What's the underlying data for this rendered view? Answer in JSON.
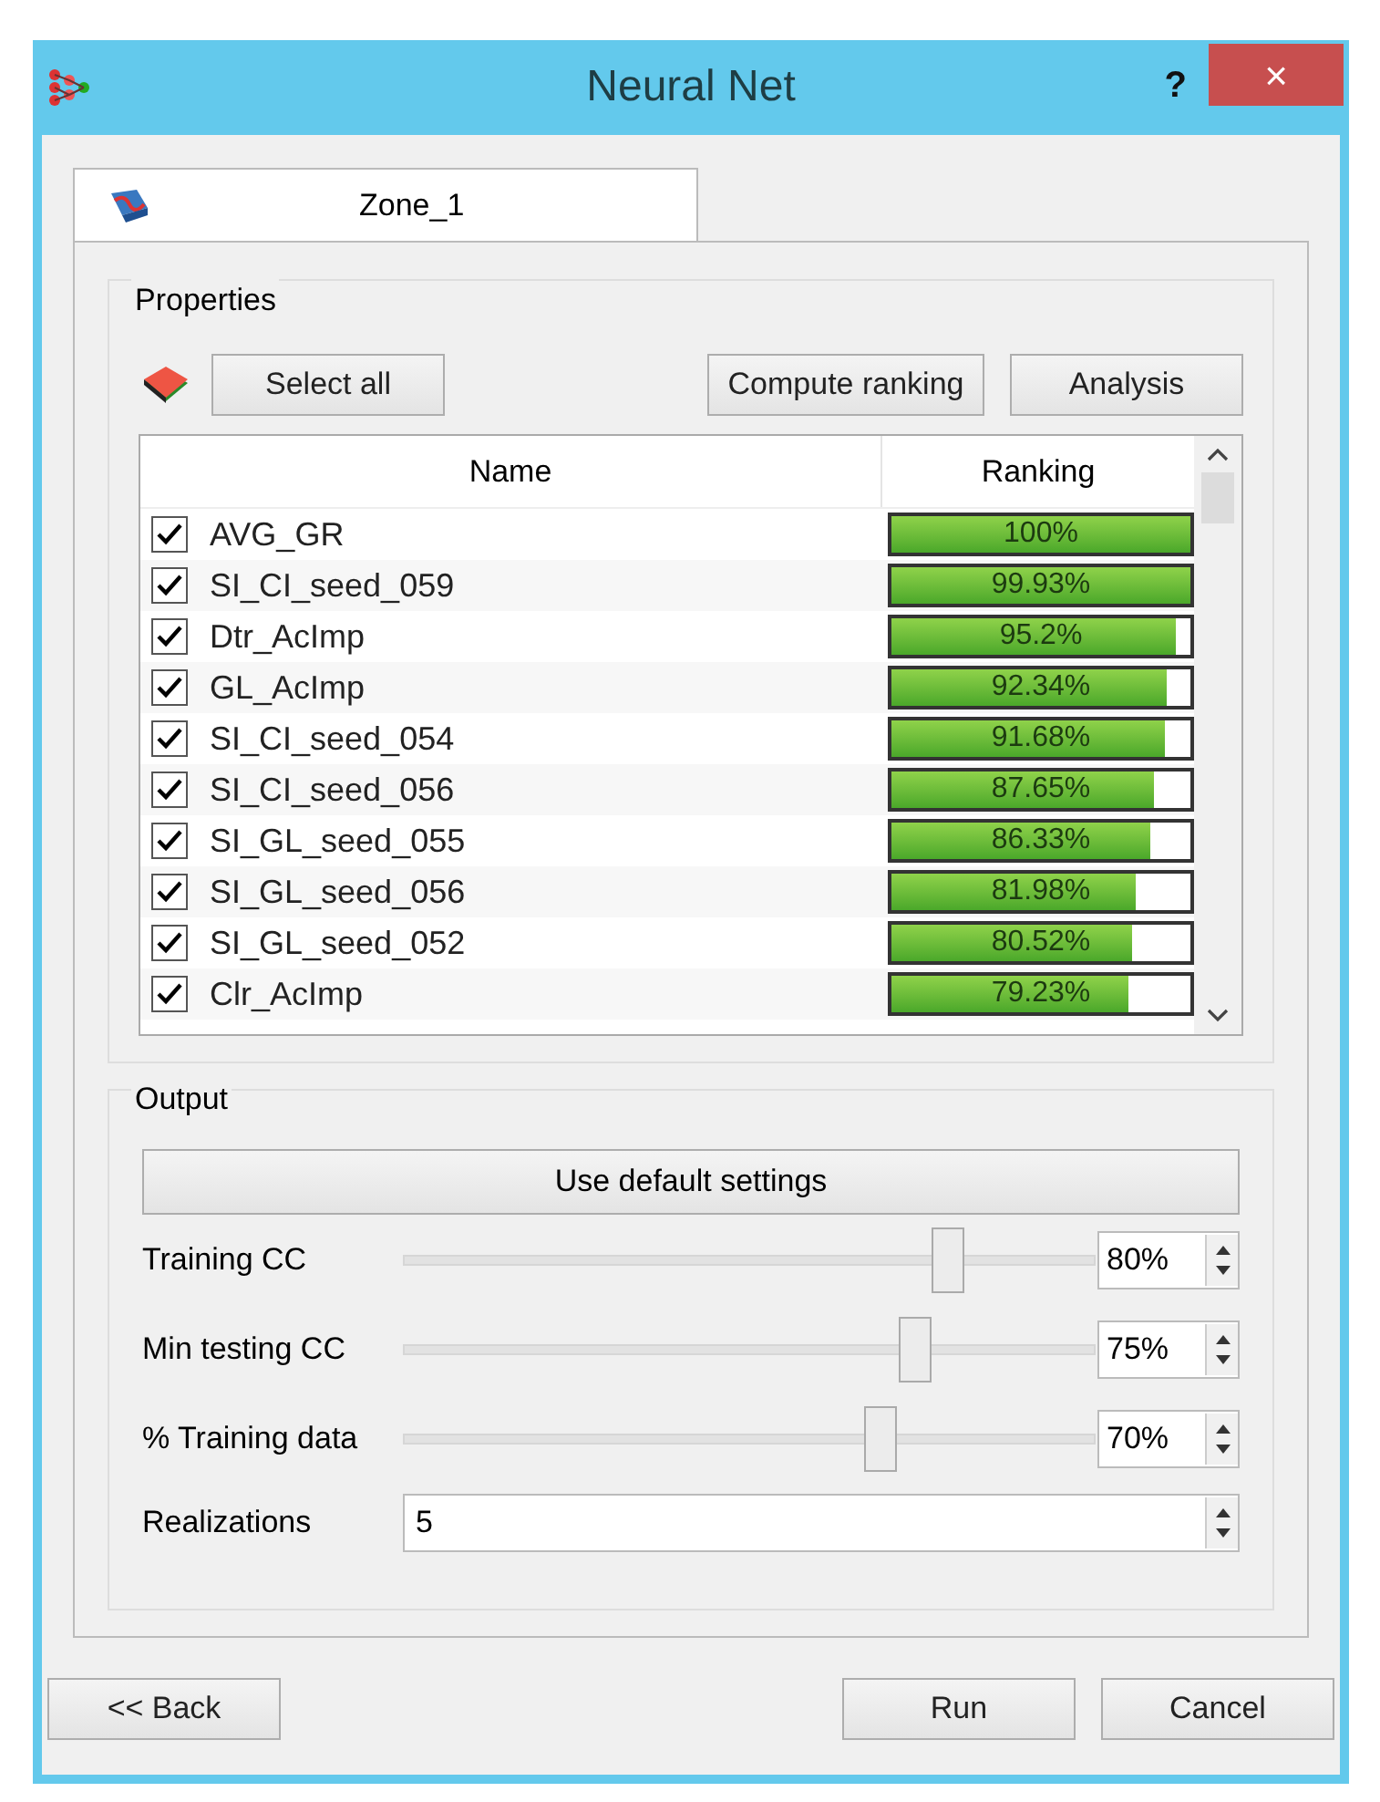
{
  "window": {
    "title": "Neural Net",
    "help": "?",
    "close": "×"
  },
  "tabs": [
    {
      "label": "Zone_1",
      "selected": true
    }
  ],
  "properties": {
    "title": "Properties",
    "buttons": [
      "Select all",
      "Compute ranking",
      "Analysis"
    ],
    "columns": [
      "Name",
      "Ranking"
    ],
    "rows": [
      {
        "name": "AVG_GR",
        "checked": true,
        "level": 1.0,
        "ranking": "100%"
      },
      {
        "name": "SI_CI_seed_059",
        "checked": true,
        "level": 0.9993,
        "ranking": "99.93%"
      },
      {
        "name": "Dtr_AcImp",
        "checked": true,
        "level": 0.952,
        "ranking": "95.2%"
      },
      {
        "name": "GL_AcImp",
        "checked": true,
        "level": 0.9234,
        "ranking": "92.34%"
      },
      {
        "name": "SI_CI_seed_054",
        "checked": true,
        "level": 0.9168,
        "ranking": "91.68%"
      },
      {
        "name": "SI_CI_seed_056",
        "checked": true,
        "level": 0.8765,
        "ranking": "87.65%"
      },
      {
        "name": "SI_GL_seed_055",
        "checked": true,
        "level": 0.8633,
        "ranking": "86.33%"
      },
      {
        "name": "SI_GL_seed_056",
        "checked": true,
        "level": 0.8198,
        "ranking": "81.98%"
      },
      {
        "name": "SI_GL_seed_052",
        "checked": true,
        "level": 0.8052,
        "ranking": "80.52%"
      },
      {
        "name": "Clr_AcImp",
        "checked": true,
        "level": 0.7923,
        "ranking": "79.23%"
      }
    ]
  },
  "output": {
    "title": "Output",
    "default_button": "Use default settings",
    "sliders": [
      {
        "label": "Training CC",
        "level": 0.8,
        "value": "80%"
      },
      {
        "label": "Min testing CC",
        "level": 0.75,
        "value": "75%"
      },
      {
        "label": "% Training data",
        "level": 0.7,
        "value": "70%"
      }
    ],
    "realizations": {
      "label": "Realizations",
      "value": "5"
    }
  },
  "buttons": [
    "<< Back",
    "Run",
    "Cancel"
  ]
}
